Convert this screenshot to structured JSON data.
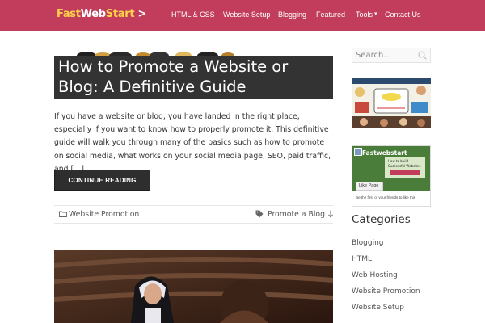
{
  "header": {
    "logo": {
      "part1": "Fast",
      "part2": "Web",
      "part3": "Start",
      "part4": " >"
    },
    "nav": [
      {
        "label": "HTML & CSS"
      },
      {
        "label": "Website Setup"
      },
      {
        "label": "Blogging"
      },
      {
        "label": "Featured"
      },
      {
        "label": "Tools"
      },
      {
        "label": "Contact Us"
      }
    ],
    "colors": {
      "bar": "#c13d5b",
      "logo_accent": "#ffd24a"
    }
  },
  "post": {
    "title": "How to Promote a Website or Blog: A Definitive Guide",
    "excerpt": "If you have a website or blog, you have landed in the right place, especially if you want to know how to properly promote it. This definitive guide will walk you through many of the basics such as how to promote on social media, what works on your social media page, SEO, paid traffic, and […]",
    "read_more": "CONTINUE READING",
    "category": "Website Promotion",
    "tag": "Promote a Blog",
    "icons": [
      "folder-icon",
      "tag-icon",
      "arrow-down-icon"
    ]
  },
  "sidebar": {
    "search_placeholder": "Search...",
    "search_icon": "search-icon",
    "facebook": {
      "page_name": "Fastwebstart",
      "like_label": "Like Page",
      "friends_text": "Be the first of your friends to like this"
    },
    "categories_title": "Categories",
    "categories": [
      {
        "label": "Blogging"
      },
      {
        "label": "HTML"
      },
      {
        "label": "Web Hosting"
      },
      {
        "label": "Website Promotion"
      },
      {
        "label": "Website Setup"
      }
    ]
  }
}
